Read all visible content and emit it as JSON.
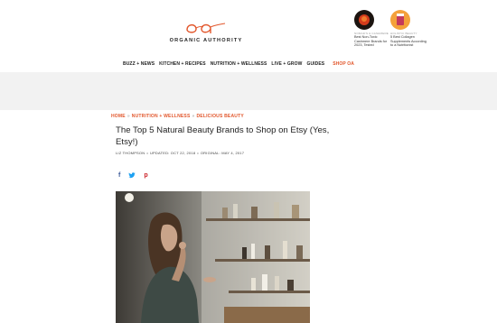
{
  "brand": {
    "logo_mark": "oa",
    "name": "ORGANIC AUTHORITY"
  },
  "promos": [
    {
      "kicker": "NOMAD'S & CASHMERE",
      "title": "Best Non-Toxic Cashmere Brands for 2023, Tested"
    },
    {
      "kicker": "HOLISTIC BEAUTY",
      "title": "5 Best Collagen Supplements According to a Nutritionist"
    }
  ],
  "nav": {
    "items": [
      "BUZZ + NEWS",
      "KITCHEN + RECIPES",
      "NUTRITION + WELLNESS",
      "LIVE + GROW",
      "GUIDES"
    ],
    "shop": "SHOP OA"
  },
  "breadcrumb": [
    "HOME",
    "NUTRITION + WELLNESS",
    "DELICIOUS BEAUTY"
  ],
  "breadcrumb_sep": "»",
  "article": {
    "headline": "The Top 5 Natural Beauty Brands to Shop on Etsy (Yes, Etsy!)",
    "author": "LIZ THOMPSON",
    "updated": "UPDATED: OCT 22, 2018",
    "original": "ORIGINAL: MAY 4, 2017"
  },
  "share": {
    "facebook": "f",
    "twitter": "t",
    "pinterest": "p"
  },
  "colors": {
    "accent": "#e2572c",
    "facebook": "#3b5998",
    "twitter": "#1da1f2",
    "pinterest": "#cb2027"
  }
}
